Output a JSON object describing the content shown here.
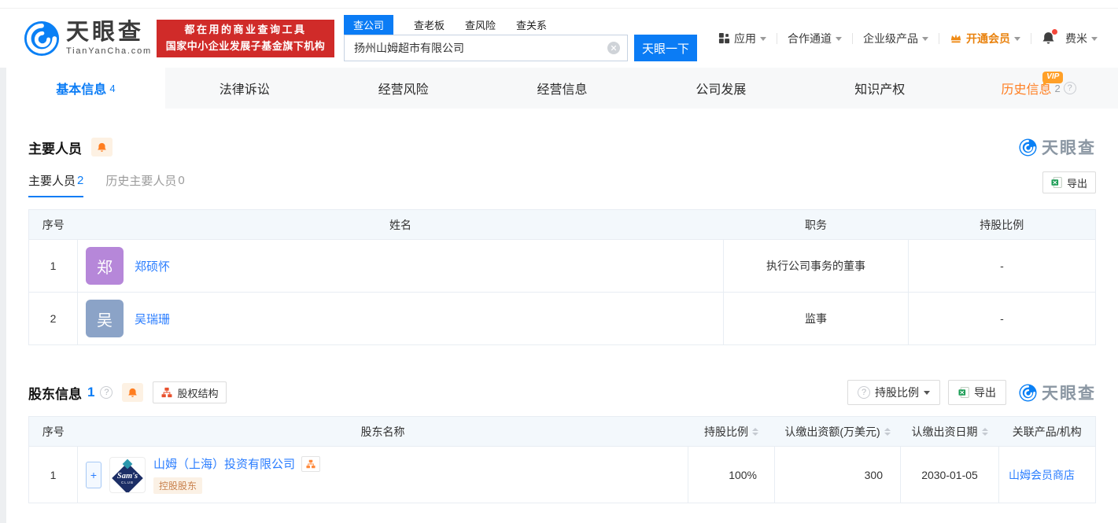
{
  "common": {
    "watermark": "天眼查"
  },
  "icons": {
    "question": "?",
    "plus": "+"
  },
  "header": {
    "logo": {
      "brand": "天眼查",
      "domain": "TianYanCha.com"
    },
    "slogan": {
      "line1": "都在用的商业查询工具",
      "line2": "国家中小企业发展子基金旗下机构"
    },
    "search": {
      "tabs": [
        {
          "label": "查公司",
          "active": true
        },
        {
          "label": "查老板"
        },
        {
          "label": "查风险"
        },
        {
          "label": "查关系"
        }
      ],
      "value": "扬州山姆超市有限公司",
      "button": "天眼一下"
    },
    "nav": {
      "apps": "应用",
      "partner": "合作通道",
      "enterprise": "企业级产品",
      "vip": "开通会员",
      "user": "费米"
    }
  },
  "tabbar": {
    "vip_label": "VIP",
    "tabs": [
      {
        "label": "基本信息",
        "count": "4",
        "active": true
      },
      {
        "label": "法律诉讼"
      },
      {
        "label": "经营风险"
      },
      {
        "label": "经营信息"
      },
      {
        "label": "公司发展"
      },
      {
        "label": "知识产权"
      },
      {
        "label": "历史信息",
        "count": "2",
        "vip": true
      }
    ]
  },
  "staff_section": {
    "title": "主要人员",
    "subtabs": [
      {
        "label": "主要人员",
        "count": "2",
        "active": true
      },
      {
        "label": "历史主要人员",
        "count": "0"
      }
    ],
    "export_label": "导出",
    "table": {
      "headers": [
        "序号",
        "姓名",
        "职务",
        "持股比例"
      ],
      "rows": [
        {
          "index": "1",
          "avatar_char": "郑",
          "avatar_style": "background:#b687d9",
          "name": "郑硕怀",
          "position": "执行公司事务的董事",
          "ratio": "-"
        },
        {
          "index": "2",
          "avatar_char": "吴",
          "avatar_style": "background:#8ba3c7",
          "name": "吴瑞珊",
          "position": "监事",
          "ratio": "-"
        }
      ]
    }
  },
  "shareholder_section": {
    "title": "股东信息",
    "count": "1",
    "equity_structure_label": "股权结构",
    "ratio_filter_label": "持股比例",
    "export_label": "导出",
    "table": {
      "headers": [
        "序号",
        "股东名称",
        "持股比例",
        "认缴出资额(万美元)",
        "认缴出资日期",
        "关联产品/机构"
      ],
      "rows": [
        {
          "index": "1",
          "logo_text": "Sam's",
          "logo_sub": "CLUB",
          "name": "山姆（上海）投资有限公司",
          "tag": "控股股东",
          "ratio": "100%",
          "amount": "300",
          "date": "2030-01-05",
          "related": "山姆会员商店"
        }
      ]
    }
  },
  "colors": {
    "primary_blue": "#0b7cf5",
    "link_blue": "#2a7dff",
    "brand_red": "#d02b29",
    "vip_orange": "#ff7e21",
    "badge_text": "#c9824e",
    "badge_bg": "#fbf1e5",
    "table_header_bg": "#f3f8fc"
  }
}
